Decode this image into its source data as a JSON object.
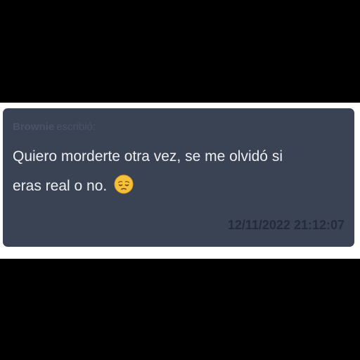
{
  "message": {
    "author": "Brownie",
    "author_verb": "escribió:",
    "text_line1": "Quiero morderte otra vez, se me olvidó si",
    "text_line2": "eras real o no.",
    "emoji": "pensive-face-emoji",
    "timestamp": "12/11/2022 21:12:07"
  },
  "colors": {
    "bubble_background": "#3a4354",
    "message_text": "#eceef2",
    "author_text": "#4a5468",
    "timestamp_text": "#252c38",
    "emoji_face": "#f6c13a"
  }
}
